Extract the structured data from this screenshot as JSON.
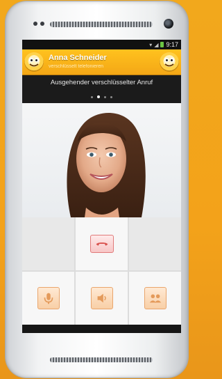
{
  "statusbar": {
    "time": "9:17",
    "wifi_icon": "wifi-icon",
    "signal_icon": "signal-icon",
    "battery_icon": "battery-icon"
  },
  "call": {
    "contact_name": "Anna Schneider",
    "contact_subtitle": "verschlüsselt telefonieren",
    "status_text": "Ausgehender verschlüsselter Anruf",
    "pager_dots": 4,
    "active_dot": 2
  },
  "controls": {
    "hangup_icon": "phone-hangup-icon",
    "mute_icon": "microphone-icon",
    "speaker_icon": "speaker-icon",
    "contacts_icon": "contacts-icon"
  },
  "colors": {
    "accent": "#f4a716",
    "background": "#f2a81c",
    "hangup": "#e07a7a"
  }
}
